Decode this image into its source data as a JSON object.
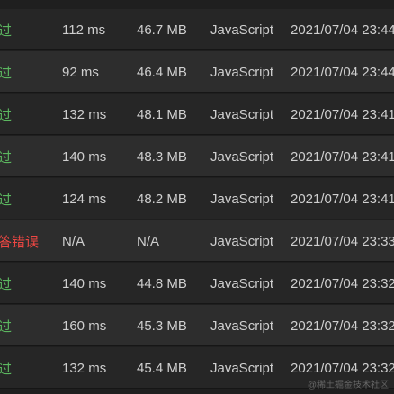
{
  "colors": {
    "accepted": "#5bb65f",
    "wrong_answer": "#ef4743",
    "row_text": "#cfcfcf"
  },
  "submissions": [
    {
      "status": "过",
      "status_type": "accepted",
      "runtime": "112 ms",
      "memory": "46.7 MB",
      "language": "JavaScript",
      "submitted_at": "2021/07/04 23:44"
    },
    {
      "status": "过",
      "status_type": "accepted",
      "runtime": "92 ms",
      "memory": "46.4 MB",
      "language": "JavaScript",
      "submitted_at": "2021/07/04 23:44"
    },
    {
      "status": "过",
      "status_type": "accepted",
      "runtime": "132 ms",
      "memory": "48.1 MB",
      "language": "JavaScript",
      "submitted_at": "2021/07/04 23:41"
    },
    {
      "status": "过",
      "status_type": "accepted",
      "runtime": "140 ms",
      "memory": "48.3 MB",
      "language": "JavaScript",
      "submitted_at": "2021/07/04 23:41"
    },
    {
      "status": "过",
      "status_type": "accepted",
      "runtime": "124 ms",
      "memory": "48.2 MB",
      "language": "JavaScript",
      "submitted_at": "2021/07/04 23:41"
    },
    {
      "status": "答错误",
      "status_type": "wrong_answer",
      "runtime": "N/A",
      "memory": "N/A",
      "language": "JavaScript",
      "submitted_at": "2021/07/04 23:33"
    },
    {
      "status": "过",
      "status_type": "accepted",
      "runtime": "140 ms",
      "memory": "44.8 MB",
      "language": "JavaScript",
      "submitted_at": "2021/07/04 23:32"
    },
    {
      "status": "过",
      "status_type": "accepted",
      "runtime": "160 ms",
      "memory": "45.3 MB",
      "language": "JavaScript",
      "submitted_at": "2021/07/04 23:32"
    },
    {
      "status": "过",
      "status_type": "accepted",
      "runtime": "132 ms",
      "memory": "45.4 MB",
      "language": "JavaScript",
      "submitted_at": "2021/07/04 23:32"
    }
  ],
  "watermark": "@稀土掘金技术社区"
}
